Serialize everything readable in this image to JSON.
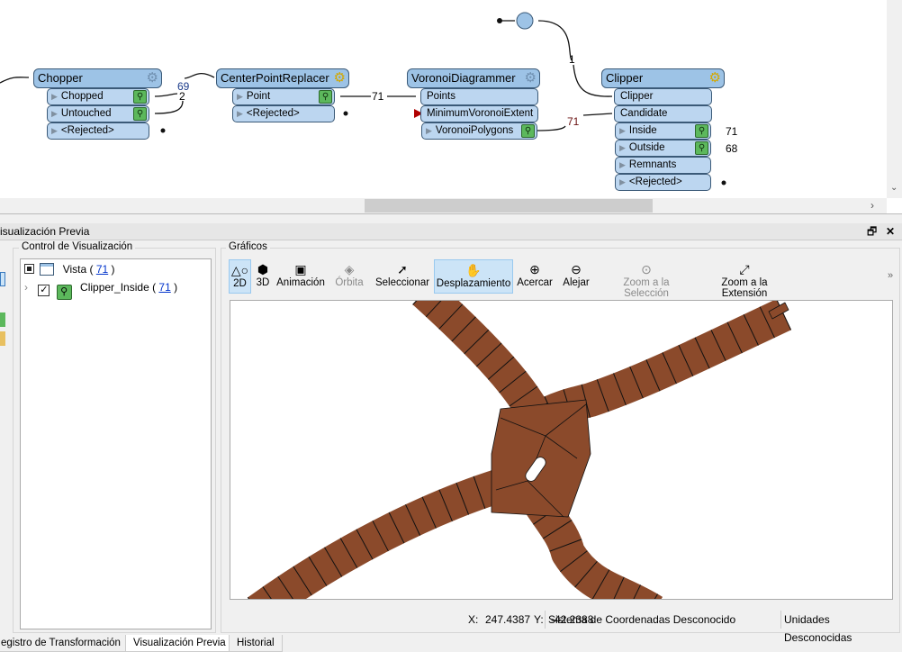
{
  "workspace": {
    "nodes": [
      {
        "name": "Chopper",
        "gear": "gear-icon",
        "ports": [
          {
            "label": "Chopped",
            "inspect": true
          },
          {
            "label": "Untouched",
            "inspect": true
          },
          {
            "label": "<Rejected>",
            "inspect": false
          }
        ]
      },
      {
        "name": "CenterPointReplacer",
        "gear": "gear-icon-active",
        "ports": [
          {
            "label": "Point",
            "inspect": true
          },
          {
            "label": "<Rejected>",
            "inspect": false
          }
        ]
      },
      {
        "name": "VoronoiDiagrammer",
        "gear": "gear-icon",
        "inputs": [
          {
            "label": "Points"
          },
          {
            "label": "MinimumVoronoiExtent"
          }
        ],
        "ports": [
          {
            "label": "VoronoiPolygons",
            "inspect": true
          }
        ]
      },
      {
        "name": "Clipper",
        "gear": "gear-icon-active",
        "inputs": [
          {
            "label": "Clipper"
          },
          {
            "label": "Candidate"
          }
        ],
        "ports": [
          {
            "label": "Inside",
            "inspect": true
          },
          {
            "label": "Outside",
            "inspect": true
          },
          {
            "label": "Remnants",
            "inspect": false
          },
          {
            "label": "<Rejected>",
            "inspect": false
          }
        ]
      }
    ],
    "counts": {
      "chopped": "69",
      "untouched": "2",
      "point": "71",
      "voronoi": "71",
      "creator": "1",
      "inside": "71",
      "outside": "68"
    }
  },
  "panel": {
    "title": "isualización Previa"
  },
  "control": {
    "title": "Control de Visualización",
    "vista_label": "Vista (",
    "vista_count": "71",
    "clipper_label": "Clipper_Inside (",
    "clipper_count": "71",
    "close_paren": ")"
  },
  "graphics": {
    "title": "Gráficos",
    "toolbar": [
      {
        "label": "2D",
        "icon": "2d-shapes-icon",
        "state": "on"
      },
      {
        "label": "3D",
        "icon": "3d-shapes-icon",
        "state": ""
      },
      {
        "label": "Animación",
        "icon": "animation-icon",
        "state": ""
      },
      {
        "label": "Órbita",
        "icon": "orbit-icon",
        "state": "dis"
      },
      {
        "label": "Seleccionar",
        "icon": "select-icon",
        "state": ""
      },
      {
        "label": "Desplazamiento",
        "icon": "pan-hand-icon",
        "state": "on"
      },
      {
        "label": "Acercar",
        "icon": "zoom-in-icon",
        "state": ""
      },
      {
        "label": "Alejar",
        "icon": "zoom-out-icon",
        "state": ""
      },
      {
        "label": "Zoom a la Selección",
        "icon": "zoom-selection-icon",
        "state": "dis"
      },
      {
        "label": "Zoom a la Extensión",
        "icon": "zoom-extent-icon",
        "state": ""
      }
    ],
    "overflow": "»",
    "fill_color": "#8b4a2b"
  },
  "status": {
    "x_label": "X:",
    "x_value": "247.4387",
    "y_label": "Y:",
    "y_value": "-42.2388",
    "crs": "Sistema de Coordenadas Desconocido",
    "units": "Unidades Desconocidas"
  },
  "tabs": [
    {
      "label": "egistro de Transformación"
    },
    {
      "label": "Visualización Previa",
      "active": true
    },
    {
      "label": "Historial"
    }
  ]
}
